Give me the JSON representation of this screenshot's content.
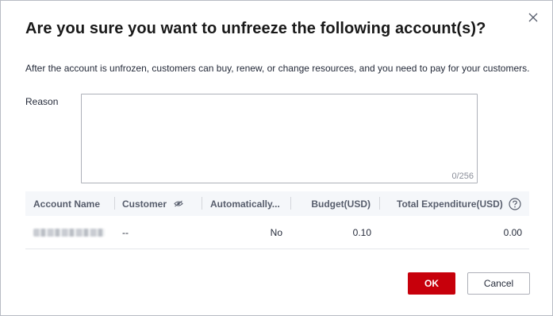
{
  "dialog": {
    "title": "Are you sure you want to unfreeze the following account(s)?",
    "description": "After the account is unfrozen, customers can buy, renew, or change resources, and you need to pay for your customers.",
    "close_icon": "close-icon"
  },
  "reason": {
    "label": "Reason",
    "value": "",
    "counter": "0/256"
  },
  "table": {
    "columns": {
      "account_name": "Account Name",
      "customer": "Customer",
      "customer_icon": "eye-hidden-icon",
      "automatically": "Automatically...",
      "budget": "Budget(USD)",
      "total_expenditure": "Total Expenditure(USD)",
      "help_icon": "help-icon"
    },
    "rows": [
      {
        "account_name": "",
        "customer": "--",
        "automatically": "No",
        "budget": "0.10",
        "total_expenditure": "0.00"
      }
    ]
  },
  "buttons": {
    "ok": "OK",
    "cancel": "Cancel"
  },
  "colors": {
    "primary": "#c7000b",
    "header_bg": "#f5f7fa",
    "border": "#adb0b8"
  }
}
